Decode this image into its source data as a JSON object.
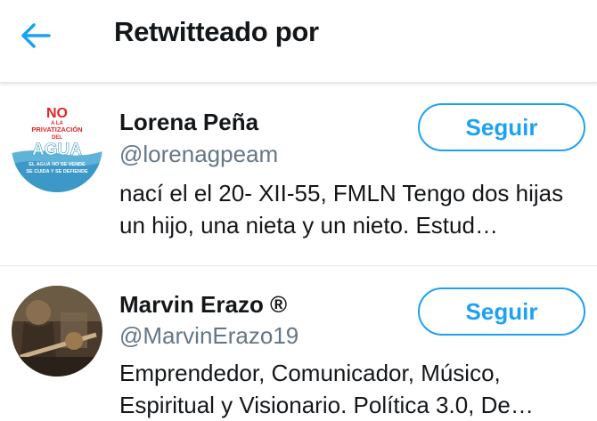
{
  "header": {
    "title": "Retwitteado por",
    "back_icon": "arrow-left-icon",
    "accent": "#1da1f2"
  },
  "users": [
    {
      "name": "Lorena Peña",
      "handle": "@lorenagpeam",
      "bio": "nací el el 20- XII-55, FMLN Tengo dos hijas un hijo, una nieta y un nieto. Estud…",
      "follow_label": "Seguir",
      "avatar_text": {
        "no": "NO",
        "a_la": "A LA",
        "privatizacion": "PRIVATIZACIÓN",
        "del": "DEL",
        "agua": "AGUA",
        "line1": "EL AGUA NO SE VENDE",
        "line2": "SE CUIDA Y SE DEFIENDE"
      }
    },
    {
      "name": "Marvin Erazo ®",
      "handle": "@MarvinErazo19",
      "bio": "Emprendedor, Comunicador,  Músico, Espiritual y Visionario. Política 3.0, De…",
      "follow_label": "Seguir"
    }
  ],
  "colors": {
    "accent": "#1da1f2",
    "text_primary": "#14171a",
    "text_secondary": "#657786",
    "divider": "#e1e8ed"
  }
}
